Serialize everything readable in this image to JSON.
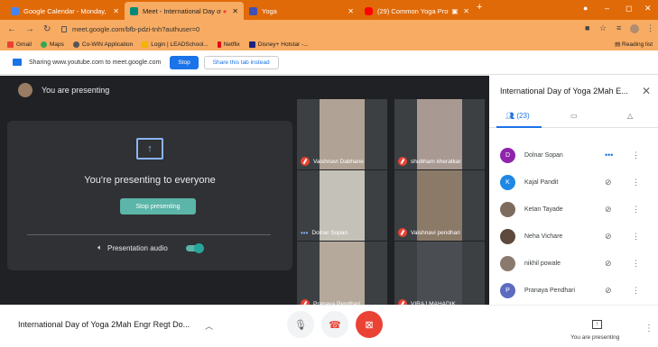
{
  "browser": {
    "tabs": [
      {
        "title": "Google Calendar - Monday, 21 J",
        "color": "#4285f4"
      },
      {
        "title": "Meet - International Day of",
        "color": "#00897b"
      },
      {
        "title": "Yoga",
        "color": "#3f51b5"
      },
      {
        "title": "(29) Common Yoga Protoco",
        "color": "#ff0000"
      }
    ],
    "new_tab": "+",
    "url": "meet.google.com/bfb-pdzi-tnh?authuser=0",
    "bookmarks": [
      "Gmail",
      "Maps",
      "Co-WIN Application",
      "Login | LEADSchool...",
      "Netflix",
      "Disney+ Hotstar -..."
    ],
    "reading_list": "Reading list"
  },
  "share_bar": {
    "text": "Sharing www.youtube.com to meet.google.com",
    "stop": "Stop",
    "share_instead": "Share this tab instead"
  },
  "meet": {
    "presenting_header": "You are presenting",
    "presenting_msg": "You're presenting to everyone",
    "stop_presenting": "Stop presenting",
    "presentation_audio": "Presentation audio",
    "tiles": [
      {
        "name": "Vaishnavi Dabhane",
        "muted": true
      },
      {
        "name": "shubham kheratkar",
        "muted": true
      },
      {
        "name": "Dolnar Sopan",
        "muted": false
      },
      {
        "name": "Vaishnavi pendhari",
        "muted": true
      },
      {
        "name": "Pranaya Pendhari",
        "muted": true
      },
      {
        "name": "VIRAJ MAHADIK",
        "muted": true
      }
    ]
  },
  "panel": {
    "title": "International Day of Yoga 2Mah E...",
    "people_count": "(23)",
    "participants": [
      {
        "name": "Dolnar Sopan",
        "initial": "D",
        "color": "#8e24aa",
        "status": "speaking"
      },
      {
        "name": "Kajal Pandit",
        "initial": "K",
        "color": "#1e88e5",
        "status": "muted"
      },
      {
        "name": "Ketan Tayade",
        "initial": "",
        "color": "#7d6b5d",
        "status": "muted"
      },
      {
        "name": "Neha Vichare",
        "initial": "",
        "color": "#5d4a3c",
        "status": "muted"
      },
      {
        "name": "nikhil powale",
        "initial": "",
        "color": "#8a7a6e",
        "status": "muted"
      },
      {
        "name": "Pranaya Pendhari",
        "initial": "P",
        "color": "#5c6bc0",
        "status": "muted"
      }
    ]
  },
  "bottom": {
    "meeting_title": "International Day of Yoga 2Mah Engr Regt Do...",
    "you_are_presenting": "You are presenting"
  }
}
